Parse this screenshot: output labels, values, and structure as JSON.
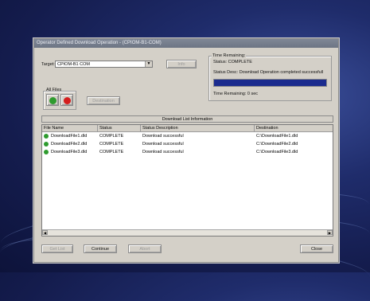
{
  "window": {
    "title": "Operator Defined Download Operation - (CPIOM-B1-COM)"
  },
  "target": {
    "label": "Target:",
    "value": "CPIOM-B1 COM"
  },
  "buttons": {
    "info": "Info",
    "destination": "Destination",
    "get_list": "Get List",
    "continue": "Continue",
    "abort": "Abort",
    "close": "Close"
  },
  "all_files": {
    "label": "All Files"
  },
  "time_remaining": {
    "group_title": "Time Remaining:",
    "status": "Status: COMPLETE",
    "status_desc": "Status Desc: Download Operation completed successfull",
    "remaining": "Time Remaining: 0 sec",
    "progress_fraction": 1.0
  },
  "download_list": {
    "title": "Download List Information",
    "columns": [
      "File Name",
      "Status",
      "Status Description",
      "Destination"
    ],
    "rows": [
      {
        "file": "DownloadFile1.dld",
        "status": "COMPLETE",
        "desc": "Download successful",
        "dest": "C:\\DownloadFile1.dld"
      },
      {
        "file": "DownloadFile2.dld",
        "status": "COMPLETE",
        "desc": "Download successful",
        "dest": "C:\\DownloadFile2.dld"
      },
      {
        "file": "DownloadFile3.dld",
        "status": "COMPLETE",
        "desc": "Download successful",
        "dest": "C:\\DownloadFile3.dld"
      }
    ]
  },
  "colors": {
    "progress": "#1b2b8e",
    "ok_green": "#2e9b2e",
    "stop_red": "#d41e1e"
  }
}
